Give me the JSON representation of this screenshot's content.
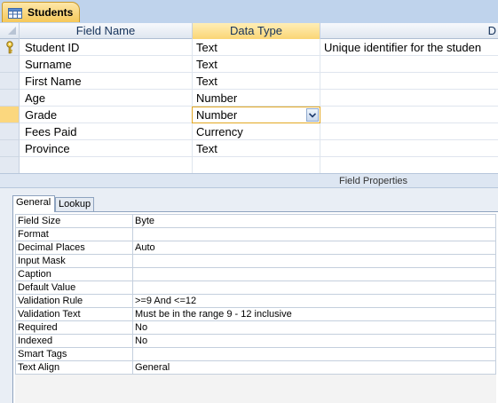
{
  "tab": {
    "title": "Students",
    "icon": "table-icon"
  },
  "grid": {
    "headers": {
      "field_name": "Field Name",
      "data_type": "Data Type",
      "description": "D"
    },
    "rows": [
      {
        "name": "Student ID",
        "type": "Text",
        "description": "Unique identifier for the studen",
        "primary_key": true
      },
      {
        "name": "Surname",
        "type": "Text",
        "description": ""
      },
      {
        "name": "First Name",
        "type": "Text",
        "description": ""
      },
      {
        "name": "Age",
        "type": "Number",
        "description": ""
      },
      {
        "name": "Grade",
        "type": "Number",
        "description": "",
        "selected": true
      },
      {
        "name": "Fees Paid",
        "type": "Currency",
        "description": ""
      },
      {
        "name": "Province",
        "type": "Text",
        "description": ""
      }
    ]
  },
  "field_properties": {
    "title": "Field Properties",
    "tabs": [
      {
        "label": "General",
        "active": true
      },
      {
        "label": "Lookup",
        "active": false
      }
    ],
    "properties": [
      {
        "name": "Field Size",
        "value": "Byte"
      },
      {
        "name": "Format",
        "value": ""
      },
      {
        "name": "Decimal Places",
        "value": "Auto"
      },
      {
        "name": "Input Mask",
        "value": ""
      },
      {
        "name": "Caption",
        "value": ""
      },
      {
        "name": "Default Value",
        "value": ""
      },
      {
        "name": "Validation Rule",
        "value": ">=9 And <=12"
      },
      {
        "name": "Validation Text",
        "value": "Must be in the range 9 - 12 inclusive"
      },
      {
        "name": "Required",
        "value": "No"
      },
      {
        "name": "Indexed",
        "value": "No"
      },
      {
        "name": "Smart Tags",
        "value": ""
      },
      {
        "name": "Text Align",
        "value": "General"
      }
    ]
  },
  "colors": {
    "selection": "#fbd77e",
    "active_tab": "#f5c85a",
    "header": "#dfe6f0"
  }
}
